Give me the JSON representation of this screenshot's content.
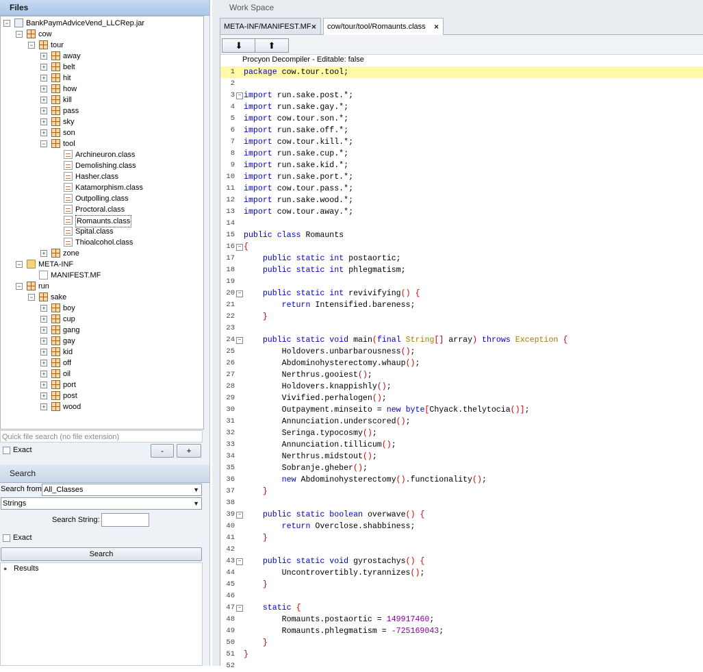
{
  "files_panel": {
    "title": "Files",
    "tree": [
      {
        "label": "BankPaymAdviceVend_LLCRep.jar",
        "icon": "jar-icon",
        "depth": 0,
        "toggle": "-"
      },
      {
        "label": "cow",
        "icon": "package-icon",
        "depth": 1,
        "toggle": "-"
      },
      {
        "label": "tour",
        "icon": "package-icon",
        "depth": 2,
        "toggle": "-"
      },
      {
        "label": "away",
        "icon": "package-icon",
        "depth": 3,
        "toggle": "+"
      },
      {
        "label": "belt",
        "icon": "package-icon",
        "depth": 3,
        "toggle": "+"
      },
      {
        "label": "hit",
        "icon": "package-icon",
        "depth": 3,
        "toggle": "+"
      },
      {
        "label": "how",
        "icon": "package-icon",
        "depth": 3,
        "toggle": "+"
      },
      {
        "label": "kill",
        "icon": "package-icon",
        "depth": 3,
        "toggle": "+"
      },
      {
        "label": "pass",
        "icon": "package-icon",
        "depth": 3,
        "toggle": "+"
      },
      {
        "label": "sky",
        "icon": "package-icon",
        "depth": 3,
        "toggle": "+"
      },
      {
        "label": "son",
        "icon": "package-icon",
        "depth": 3,
        "toggle": "+"
      },
      {
        "label": "tool",
        "icon": "package-icon",
        "depth": 3,
        "toggle": "-"
      },
      {
        "label": "Archineuron.class",
        "icon": "class-file-icon",
        "depth": 4,
        "toggle": ""
      },
      {
        "label": "Demolishing.class",
        "icon": "class-file-icon",
        "depth": 4,
        "toggle": ""
      },
      {
        "label": "Hasher.class",
        "icon": "class-file-icon",
        "depth": 4,
        "toggle": ""
      },
      {
        "label": "Katamorphism.class",
        "icon": "class-file-icon",
        "depth": 4,
        "toggle": ""
      },
      {
        "label": "Outpolling.class",
        "icon": "class-file-icon",
        "depth": 4,
        "toggle": ""
      },
      {
        "label": "Proctoral.class",
        "icon": "class-file-icon",
        "depth": 4,
        "toggle": ""
      },
      {
        "label": "Romaunts.class",
        "icon": "class-file-icon",
        "depth": 4,
        "toggle": "",
        "selected": true
      },
      {
        "label": "Spital.class",
        "icon": "class-file-icon",
        "depth": 4,
        "toggle": ""
      },
      {
        "label": "Thioalcohol.class",
        "icon": "class-file-icon",
        "depth": 4,
        "toggle": ""
      },
      {
        "label": "zone",
        "icon": "package-icon",
        "depth": 3,
        "toggle": "+"
      },
      {
        "label": "META-INF",
        "icon": "folder-icon",
        "depth": 1,
        "toggle": "-"
      },
      {
        "label": "MANIFEST.MF",
        "icon": "manifest-file-icon",
        "depth": 2,
        "toggle": ""
      },
      {
        "label": "run",
        "icon": "package-icon",
        "depth": 1,
        "toggle": "-"
      },
      {
        "label": "sake",
        "icon": "package-icon",
        "depth": 2,
        "toggle": "-"
      },
      {
        "label": "boy",
        "icon": "package-icon",
        "depth": 3,
        "toggle": "+"
      },
      {
        "label": "cup",
        "icon": "package-icon",
        "depth": 3,
        "toggle": "+"
      },
      {
        "label": "gang",
        "icon": "package-icon",
        "depth": 3,
        "toggle": "+"
      },
      {
        "label": "gay",
        "icon": "package-icon",
        "depth": 3,
        "toggle": "+"
      },
      {
        "label": "kid",
        "icon": "package-icon",
        "depth": 3,
        "toggle": "+"
      },
      {
        "label": "off",
        "icon": "package-icon",
        "depth": 3,
        "toggle": "+"
      },
      {
        "label": "oil",
        "icon": "package-icon",
        "depth": 3,
        "toggle": "+"
      },
      {
        "label": "port",
        "icon": "package-icon",
        "depth": 3,
        "toggle": "+"
      },
      {
        "label": "post",
        "icon": "package-icon",
        "depth": 3,
        "toggle": "+"
      },
      {
        "label": "wood",
        "icon": "package-icon",
        "depth": 3,
        "toggle": "+"
      }
    ],
    "quick_search_placeholder": "Quick file search (no file extension)",
    "exact_label": "Exact",
    "minus_label": "-",
    "plus_label": "+"
  },
  "search_panel": {
    "title": "Search",
    "search_from_label": "Search from",
    "search_from_value": "All_Classes",
    "type_value": "Strings",
    "search_string_label": "Search String:",
    "search_string_value": "",
    "exact_label": "Exact",
    "search_button": "Search",
    "results_label": "Results"
  },
  "workspace": {
    "title": "Work Space",
    "tabs": [
      {
        "label": "META-INF/MANIFEST.MF",
        "active": false
      },
      {
        "label": "cow/tour/tool/Romaunts.class",
        "active": true
      }
    ],
    "toolbar": {
      "download_icon": "download-icon",
      "upload_icon": "upload-icon"
    },
    "decompiler_label": "Procyon Decompiler - Editable: false",
    "code_lines": [
      "package cow.tour.tool;",
      "",
      "import run.sake.post.*;",
      "import run.sake.gay.*;",
      "import cow.tour.son.*;",
      "import run.sake.off.*;",
      "import cow.tour.kill.*;",
      "import run.sake.cup.*;",
      "import run.sake.kid.*;",
      "import run.sake.port.*;",
      "import cow.tour.pass.*;",
      "import run.sake.wood.*;",
      "import cow.tour.away.*;",
      "",
      "public class Romaunts",
      "{",
      "    public static int postaortic;",
      "    public static int phlegmatism;",
      "",
      "    public static int revivifying() {",
      "        return Intensified.bareness;",
      "    }",
      "",
      "    public static void main(final String[] array) throws Exception {",
      "        Holdovers.unbarbarousness();",
      "        Abdominohysterectomy.whaup();",
      "        Nerthrus.gooiest();",
      "        Holdovers.knappishly();",
      "        Vivified.perhalogen();",
      "        Outpayment.minseito = new byte[Chyack.thelytocia()];",
      "        Annunciation.underscored();",
      "        Seringa.typocosmy();",
      "        Annunciation.tillicum();",
      "        Nerthrus.midstout();",
      "        Sobranje.gheber();",
      "        new Abdominohysterectomy().functionality();",
      "    }",
      "",
      "    public static boolean overwave() {",
      "        return Overclose.shabbiness;",
      "    }",
      "",
      "    public static void gyrostachys() {",
      "        Uncontrovertibly.tyrannizes();",
      "    }",
      "",
      "    static {",
      "        Romaunts.postaortic = 149917460;",
      "        Romaunts.phlegmatism = -725169043;",
      "    }",
      "}",
      ""
    ],
    "fold_lines": [
      3,
      16,
      20,
      24,
      39,
      43,
      47
    ],
    "highlight_line": 1
  },
  "colors": {
    "keyword": "#0000d0",
    "type": "#a87a00",
    "bracket": "#d00000",
    "number": "#8b00a0",
    "highlight": "#fff9a8"
  }
}
